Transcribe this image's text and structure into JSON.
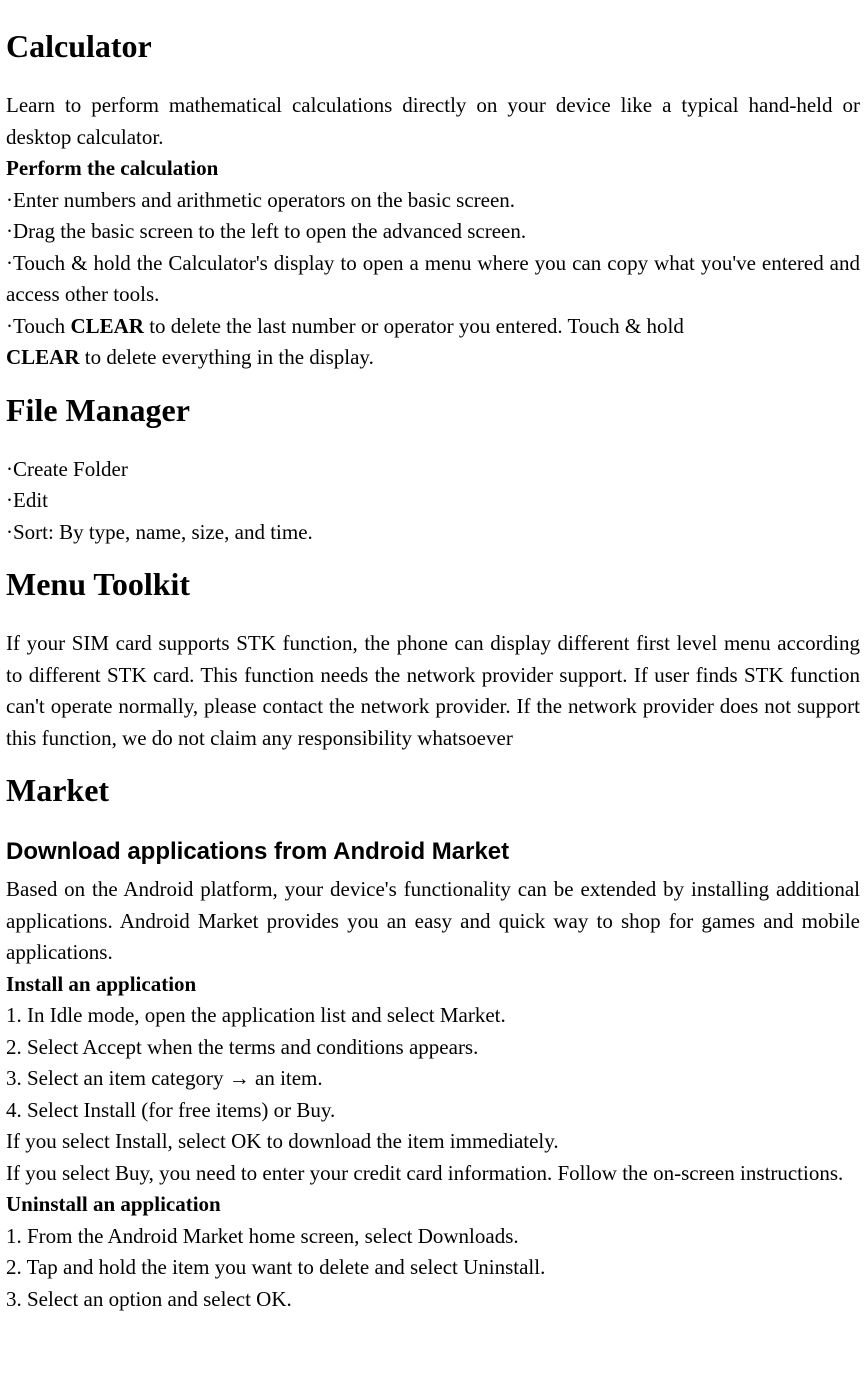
{
  "calculator": {
    "heading": "Calculator",
    "intro": "Learn to perform mathematical calculations directly on your device like a typical hand-held or desktop calculator.",
    "perform_heading": "Perform the calculation",
    "b1": "·Enter numbers and arithmetic operators on the basic screen.",
    "b2": "·Drag the basic screen to the left to open the advanced screen.",
    "b3": "·Touch & hold the Calculator's display to open a menu where you can copy what you've entered and access other tools.",
    "b4_pre": "·Touch ",
    "b4_bold": "CLEAR",
    "b4_post": " to delete the last number or operator you entered. Touch & hold",
    "b5_bold": "CLEAR",
    "b5_post": " to delete everything in the display."
  },
  "filemanager": {
    "heading": "File Manager",
    "b1": "·Create Folder",
    "b2": "·Edit",
    "b3": "·Sort: By type, name, size, and time."
  },
  "menutoolkit": {
    "heading": "Menu Toolkit",
    "text": "If your SIM card supports STK function, the phone can display different first level menu according to different STK card. This function needs the network provider support. If user finds STK function can't operate normally, please contact the network provider. If the network provider does not support this function, we do not claim any responsibility whatsoever"
  },
  "market": {
    "heading": "Market",
    "sub": "Download applications from Android Market",
    "intro": "Based on the Android platform, your device's functionality can be extended by installing additional applications. Android Market provides you an easy and quick way to shop for games and mobile applications.",
    "install_heading": "Install an application",
    "i1": "1. In Idle mode, open the application list and select Market.",
    "i2": "2. Select Accept when the terms and conditions appears.",
    "i3": "3. Select an item category  →  an item.",
    "i4": "4. Select Install (for free items) or Buy.",
    "i5": "If you select Install, select OK to download the item immediately.",
    "i6": "If you select Buy, you need to enter your credit card information. Follow the on-screen instructions.",
    "uninstall_heading": "Uninstall an application",
    "u1": "1. From the Android Market home screen, select Downloads.",
    "u2": "2. Tap and hold the item you want to delete and select Uninstall.",
    "u3": "3. Select an option and select OK."
  }
}
